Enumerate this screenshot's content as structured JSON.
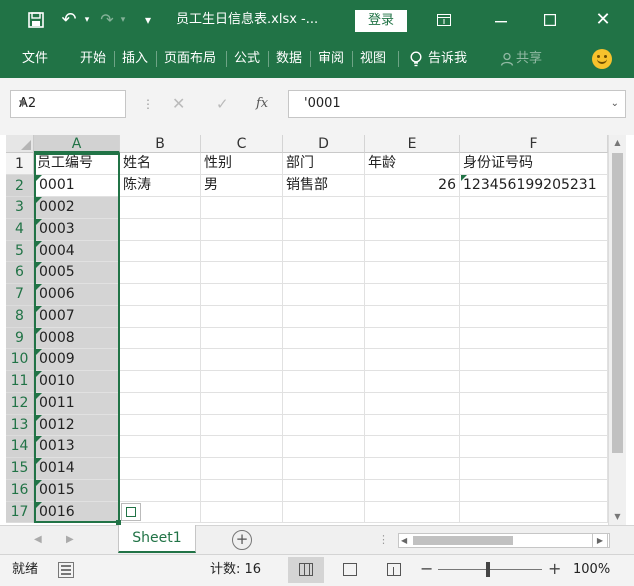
{
  "window": {
    "title": "员工生日信息表.xlsx  -...",
    "login": "登录"
  },
  "ribbon": {
    "tabs": [
      "文件",
      "开始",
      "插入",
      "页面布局",
      "公式",
      "数据",
      "审阅",
      "视图"
    ],
    "tell_me": "告诉我",
    "share": "共享"
  },
  "formula_bar": {
    "name_box": "A2",
    "fx": "fx",
    "content": "'0001"
  },
  "grid": {
    "columns": [
      "A",
      "B",
      "C",
      "D",
      "E",
      "F"
    ],
    "rows": [
      "1",
      "2",
      "3",
      "4",
      "5",
      "6",
      "7",
      "8",
      "9",
      "10",
      "11",
      "12",
      "13",
      "14",
      "15",
      "16",
      "17"
    ],
    "header_row": [
      "员工编号",
      "姓名",
      "性别",
      "部门",
      "年龄",
      "身份证号码"
    ],
    "row2": [
      "0001",
      "陈涛",
      "男",
      "销售部",
      "26",
      "123456199205231"
    ],
    "col_a_rest": [
      "0002",
      "0003",
      "0004",
      "0005",
      "0006",
      "0007",
      "0008",
      "0009",
      "0010",
      "0011",
      "0012",
      "0013",
      "0014",
      "0015",
      "0016"
    ],
    "selected_range": "A2:A17"
  },
  "sheets": {
    "tabs": [
      "Sheet1"
    ],
    "active": "Sheet1"
  },
  "status": {
    "ready": "就绪",
    "count": "计数: 16",
    "zoom": "100%"
  }
}
